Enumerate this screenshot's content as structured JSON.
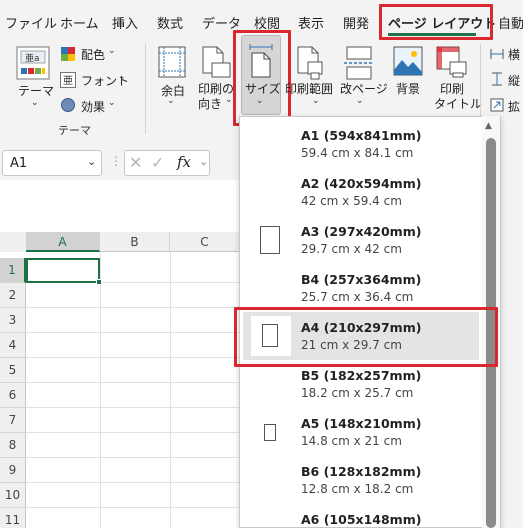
{
  "tabs": [
    "ファイル",
    "ホーム",
    "挿入",
    "数式",
    "データ",
    "校閲",
    "表示",
    "開発",
    "ページ レイアウト",
    "自動"
  ],
  "active_tab": "ページ レイアウト",
  "ribbon": {
    "theme_label": "テーマ",
    "colors_label": "配色",
    "fonts_label": "フォント",
    "effects_label": "効果",
    "group_theme": "テーマ",
    "margins_label": "余白",
    "orientation_label_1": "印刷の",
    "orientation_label_2": "向き",
    "size_label": "サイズ",
    "print_area_label": "印刷範囲",
    "breaks_label": "改ページ",
    "background_label": "背景",
    "print_titles_label_1": "印刷",
    "print_titles_label_2": "タイトル",
    "width_label": "横",
    "height_label": "縦",
    "scale_label": "拡"
  },
  "formula_bar": {
    "name_box": "A1",
    "fx_label": "fx"
  },
  "sheet": {
    "columns": [
      "A",
      "B",
      "C"
    ],
    "rows": [
      "1",
      "2",
      "3",
      "4",
      "5",
      "6",
      "7",
      "8",
      "9",
      "10",
      "11"
    ],
    "selected_cell": "A1"
  },
  "size_menu": {
    "items": [
      {
        "title": "A1 (594x841mm)",
        "sub": "59.4 cm x 84.1 cm",
        "selected": false,
        "paper_icon": false
      },
      {
        "title": "A2 (420x594mm)",
        "sub": "42 cm x 59.4 cm",
        "selected": false,
        "paper_icon": false
      },
      {
        "title": "A3 (297x420mm)",
        "sub": "29.7 cm x 42 cm",
        "selected": false,
        "paper_icon": true
      },
      {
        "title": "B4 (257x364mm)",
        "sub": "25.7 cm x 36.4 cm",
        "selected": false,
        "paper_icon": false
      },
      {
        "title": "A4 (210x297mm)",
        "sub": "21 cm x 29.7 cm",
        "selected": true,
        "paper_icon": true
      },
      {
        "title": "B5 (182x257mm)",
        "sub": "18.2 cm x 25.7 cm",
        "selected": false,
        "paper_icon": false
      },
      {
        "title": "A5 (148x210mm)",
        "sub": "14.8 cm x 21 cm",
        "selected": false,
        "paper_icon": true
      },
      {
        "title": "B6 (128x182mm)",
        "sub": "12.8 cm x 18.2 cm",
        "selected": false,
        "paper_icon": false
      },
      {
        "title": "A6 (105x148mm)",
        "sub": "",
        "selected": false,
        "paper_icon": false
      }
    ]
  },
  "colors": {
    "highlight_red": "#d9282f",
    "excel_green": "#1e7145"
  }
}
